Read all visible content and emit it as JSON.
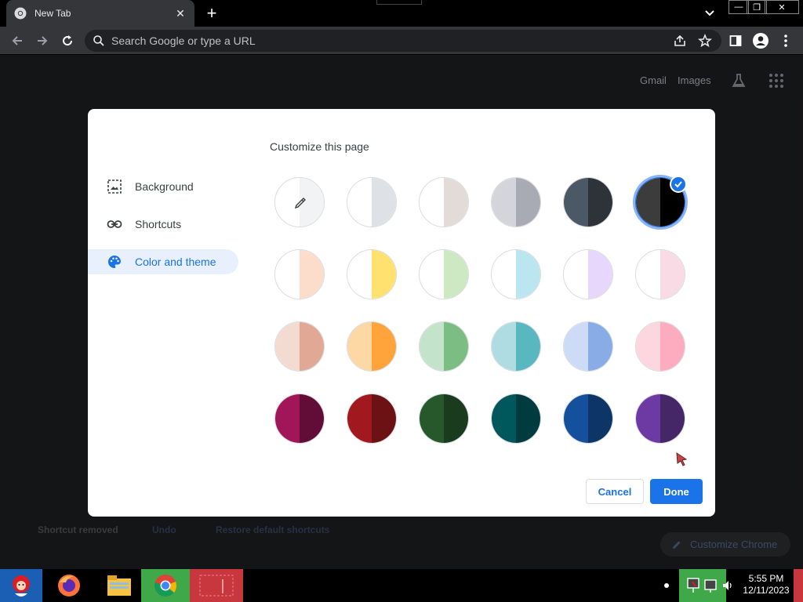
{
  "browser": {
    "tab_title": "New Tab",
    "omnibox_placeholder": "Search Google or type a URL"
  },
  "ntp": {
    "gmail": "Gmail",
    "images": "Images",
    "shortcut_removed": "Shortcut removed",
    "undo": "Undo",
    "restore_shortcuts": "Restore default shortcuts",
    "customize_chrome": "Customize Chrome"
  },
  "dialog": {
    "title": "Customize this page",
    "sidebar": [
      {
        "label": "Background",
        "icon": "image-icon"
      },
      {
        "label": "Shortcuts",
        "icon": "link-icon"
      },
      {
        "label": "Color and theme",
        "icon": "palette-icon",
        "active": true
      }
    ],
    "themes": [
      {
        "name": "custom-color-picker",
        "left": "#ffffff",
        "right": "#f1f3f4"
      },
      {
        "name": "default-light",
        "left": "#ffffff",
        "right": "#dee1e6"
      },
      {
        "name": "warm-grey",
        "left": "#ffffff",
        "right": "#e3dbd7"
      },
      {
        "name": "cool-grey",
        "left": "#d3d5da",
        "right": "#a8abb3"
      },
      {
        "name": "midnight-blue",
        "left": "#4b5866",
        "right": "#2d3339"
      },
      {
        "name": "black",
        "left": "#3c3c3c",
        "right": "#000000",
        "selected": true
      },
      {
        "name": "beige-white",
        "left": "#ffffff",
        "right": "#fcdcca"
      },
      {
        "name": "yellow-white",
        "left": "#ffffff",
        "right": "#ffe16f"
      },
      {
        "name": "green-white",
        "left": "#ffffff",
        "right": "#cde9c4"
      },
      {
        "name": "light-teal-white",
        "left": "#ffffff",
        "right": "#bbe6ef"
      },
      {
        "name": "light-purple-white",
        "left": "#ffffff",
        "right": "#e7d7fd"
      },
      {
        "name": "pink-white",
        "left": "#ffffff",
        "right": "#f9dbe6"
      },
      {
        "name": "beige",
        "left": "#f4dbd2",
        "right": "#e0a895"
      },
      {
        "name": "orange",
        "left": "#fdd7a4",
        "right": "#ffa43b"
      },
      {
        "name": "light-green",
        "left": "#c3e4cb",
        "right": "#7bbd83"
      },
      {
        "name": "light-teal",
        "left": "#aedce0",
        "right": "#58b7bf"
      },
      {
        "name": "light-blue",
        "left": "#ccdcf7",
        "right": "#89abe6"
      },
      {
        "name": "light-pink",
        "left": "#fdd6e0",
        "right": "#fdabbf"
      },
      {
        "name": "dark-pink",
        "left": "#a11659",
        "right": "#620d37"
      },
      {
        "name": "dark-red",
        "left": "#a1181e",
        "right": "#6c1215"
      },
      {
        "name": "dark-green",
        "left": "#27582b",
        "right": "#1a3b1d"
      },
      {
        "name": "dark-teal",
        "left": "#00585d",
        "right": "#003b3f"
      },
      {
        "name": "dark-blue",
        "left": "#14509c",
        "right": "#0d3565"
      },
      {
        "name": "purple",
        "left": "#6d3aa4",
        "right": "#452667"
      }
    ],
    "cancel": "Cancel",
    "done": "Done"
  },
  "taskbar": {
    "time": "5:55 PM",
    "date": "12/11/2023"
  }
}
